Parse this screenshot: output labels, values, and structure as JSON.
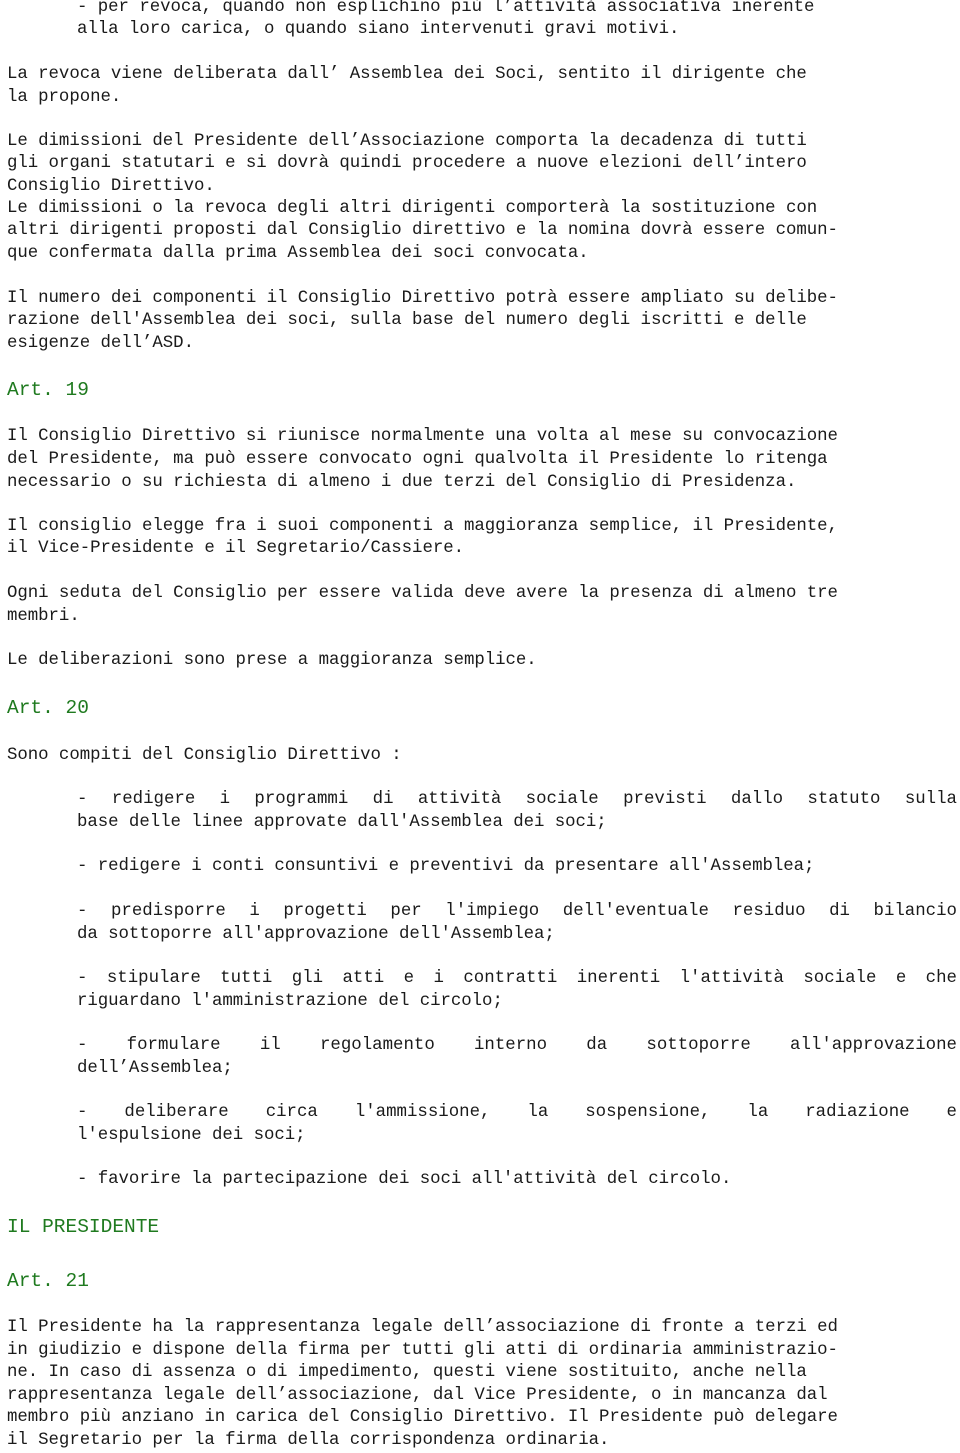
{
  "document": {
    "intro": {
      "revoca_item_lines": [
        "- per revoca, quando non esplichino più l’attività associativa inerente",
        "alla loro carica, o quando siano intervenuti gravi motivi."
      ],
      "revoca_para_lines": [
        "La revoca viene deliberata dall’ Assemblea dei Soci, sentito il dirigente che",
        "la propone."
      ],
      "dimissioni_presidente_lines": [
        "Le dimissioni del Presidente dell’Associazione comporta la decadenza di tutti",
        "gli organi statutari e si dovrà quindi procedere a nuove elezioni dell’intero",
        "Consiglio Direttivo."
      ],
      "dimissioni_altri_lines": [
        "Le dimissioni o la revoca degli altri dirigenti comporterà la sostituzione con",
        "altri dirigenti proposti dal Consiglio direttivo e la nomina dovrà essere comun-",
        "que confermata dalla prima Assemblea dei soci convocata."
      ],
      "numero_componenti_lines": [
        "Il numero dei componenti il Consiglio Direttivo potrà essere ampliato su delibe-",
        "razione dell'Assemblea dei soci, sulla base del numero degli iscritti e delle",
        "esigenze dell’ASD."
      ]
    },
    "art19": {
      "heading": "Art. 19",
      "p1_lines": [
        "Il Consiglio Direttivo si riunisce normalmente una volta al mese su convocazione",
        "del Presidente, ma può essere convocato ogni qualvolta il Presidente lo ritenga",
        "necessario o su richiesta di almeno i due terzi del Consiglio di Presidenza."
      ],
      "p2_lines": [
        "Il consiglio elegge fra i suoi componenti a maggioranza semplice, il Presidente,",
        "il Vice-Presidente e il Segretario/Cassiere."
      ],
      "p3_lines": [
        "Ogni seduta del Consiglio per essere valida deve avere la presenza di almeno tre",
        "membri."
      ],
      "p4": "Le deliberazioni sono prese a maggioranza semplice."
    },
    "art20": {
      "heading": "Art. 20",
      "intro": "Sono compiti del Consiglio Direttivo :",
      "items": [
        {
          "lines": [
            "- redigere i programmi di attività sociale previsti dallo statuto sulla",
            "base delle linee approvate dall'Assemblea dei soci;"
          ]
        },
        {
          "lines": [
            "- redigere i conti consuntivi e preventivi da presentare all'Assemblea;"
          ]
        },
        {
          "lines": [
            "- predisporre i progetti per l'impiego dell'eventuale residuo di bilancio",
            "da sottoporre all'approvazione dell'Assemblea;"
          ]
        },
        {
          "lines": [
            "- stipulare tutti gli atti e i contratti inerenti l'attività sociale e che",
            "riguardano l'amministrazione del circolo;"
          ]
        },
        {
          "lines": [
            "- formulare il regolamento interno da sottoporre all'approvazione",
            "dell’Assemblea;"
          ]
        },
        {
          "lines": [
            "- deliberare circa l'ammissione, la sospensione, la radiazione e",
            "l'espulsione dei soci;"
          ]
        },
        {
          "lines": [
            "- favorire la partecipazione dei soci all'attività del circolo."
          ]
        }
      ]
    },
    "section_president": {
      "heading": "IL PRESIDENTE"
    },
    "art21": {
      "heading": "Art. 21",
      "p1_lines": [
        "Il Presidente ha la rappresentanza legale dell’associazione di fronte a terzi ed",
        "in giudizio e dispone della firma per tutti gli atti di ordinaria amministrazio-",
        "ne. In caso di assenza o di impedimento, questi viene sostituito, anche nella",
        "rappresentanza legale dell’associazione, dal Vice Presidente, o in mancanza dal",
        "membro più anziano in carica del Consiglio Direttivo. Il Presidente può delegare",
        "il Segretario per la firma della corrispondenza ordinaria."
      ]
    },
    "colors": {
      "heading": "#1f7a1f",
      "text": "#1a1a1a",
      "background": "#ffffff"
    }
  }
}
